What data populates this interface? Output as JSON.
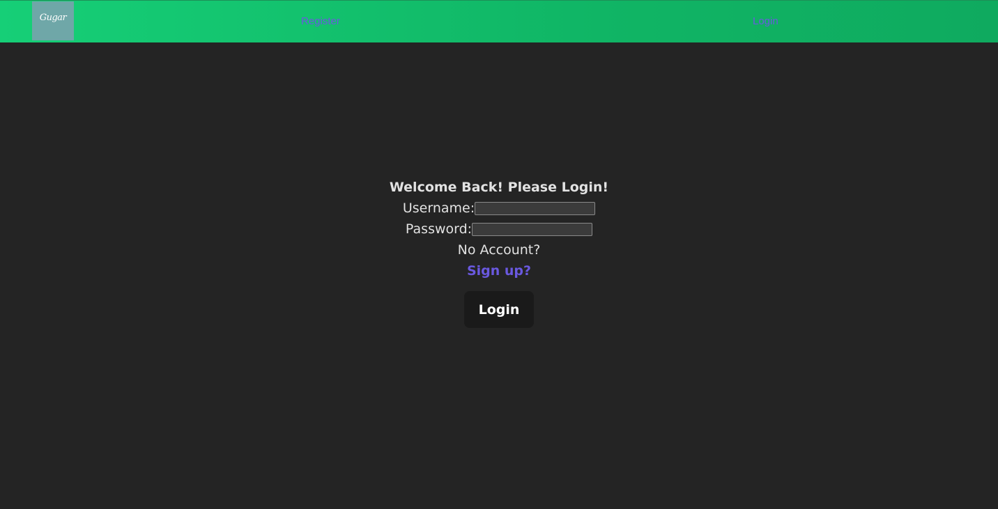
{
  "nav": {
    "logo_text": "Gugar",
    "register_label": "Register",
    "login_label": "Login",
    "background_colors": [
      "#16cf77",
      "#0faa5f"
    ],
    "link_color": "#6a59e0"
  },
  "form": {
    "title": "Welcome Back! Please Login!",
    "username_label": "Username:",
    "username_value": "",
    "password_label": "Password:",
    "password_value": "",
    "no_account_text": "No Account?",
    "signup_label": "Sign up?",
    "submit_label": "Login"
  },
  "colors": {
    "page_background": "#242424",
    "text": "#e2e2e2",
    "button_background": "#1a1a1a"
  }
}
